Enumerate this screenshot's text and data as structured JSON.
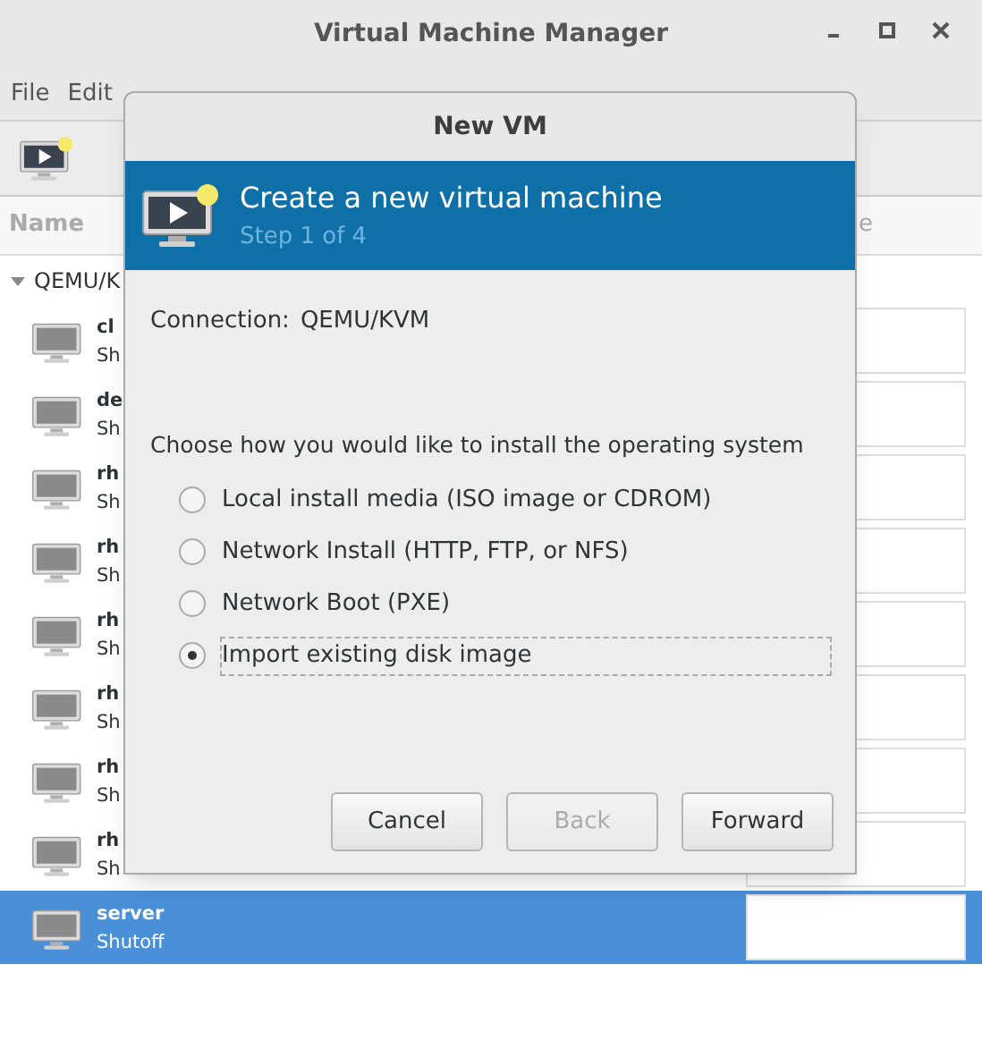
{
  "window": {
    "title": "Virtual Machine Manager"
  },
  "menu": [
    "File",
    "Edit"
  ],
  "table": {
    "columns": [
      "Name",
      "e"
    ],
    "connection": {
      "label": "QEMU/K",
      "expanded": true,
      "children": [
        {
          "name": "cl",
          "status": "Sh",
          "selected": false
        },
        {
          "name": "de",
          "status": "Sh",
          "selected": false
        },
        {
          "name": "rh",
          "status": "Sh",
          "selected": false
        },
        {
          "name": "rh",
          "status": "Sh",
          "selected": false
        },
        {
          "name": "rh",
          "status": "Sh",
          "selected": false
        },
        {
          "name": "rh",
          "status": "Sh",
          "selected": false
        },
        {
          "name": "rh",
          "status": "Sh",
          "selected": false
        },
        {
          "name": "rh",
          "status": "Sh",
          "selected": false
        },
        {
          "name": "server",
          "status": "Shutoff",
          "selected": true
        }
      ]
    }
  },
  "dialog": {
    "title": "New VM",
    "banner_title": "Create a new virtual machine",
    "step": "Step 1 of 4",
    "connection_label": "Connection:",
    "connection_value": "QEMU/KVM",
    "prompt": "Choose how you would like to install the operating system",
    "options": [
      {
        "label": "Local install media (ISO image or CDROM)",
        "selected": false
      },
      {
        "label": "Network Install (HTTP, FTP, or NFS)",
        "selected": false
      },
      {
        "label": "Network Boot (PXE)",
        "selected": false
      },
      {
        "label": "Import existing disk image",
        "selected": true
      }
    ],
    "buttons": [
      {
        "label": "Cancel",
        "disabled": false
      },
      {
        "label": "Back",
        "disabled": true
      },
      {
        "label": "Forward",
        "disabled": false
      }
    ]
  }
}
